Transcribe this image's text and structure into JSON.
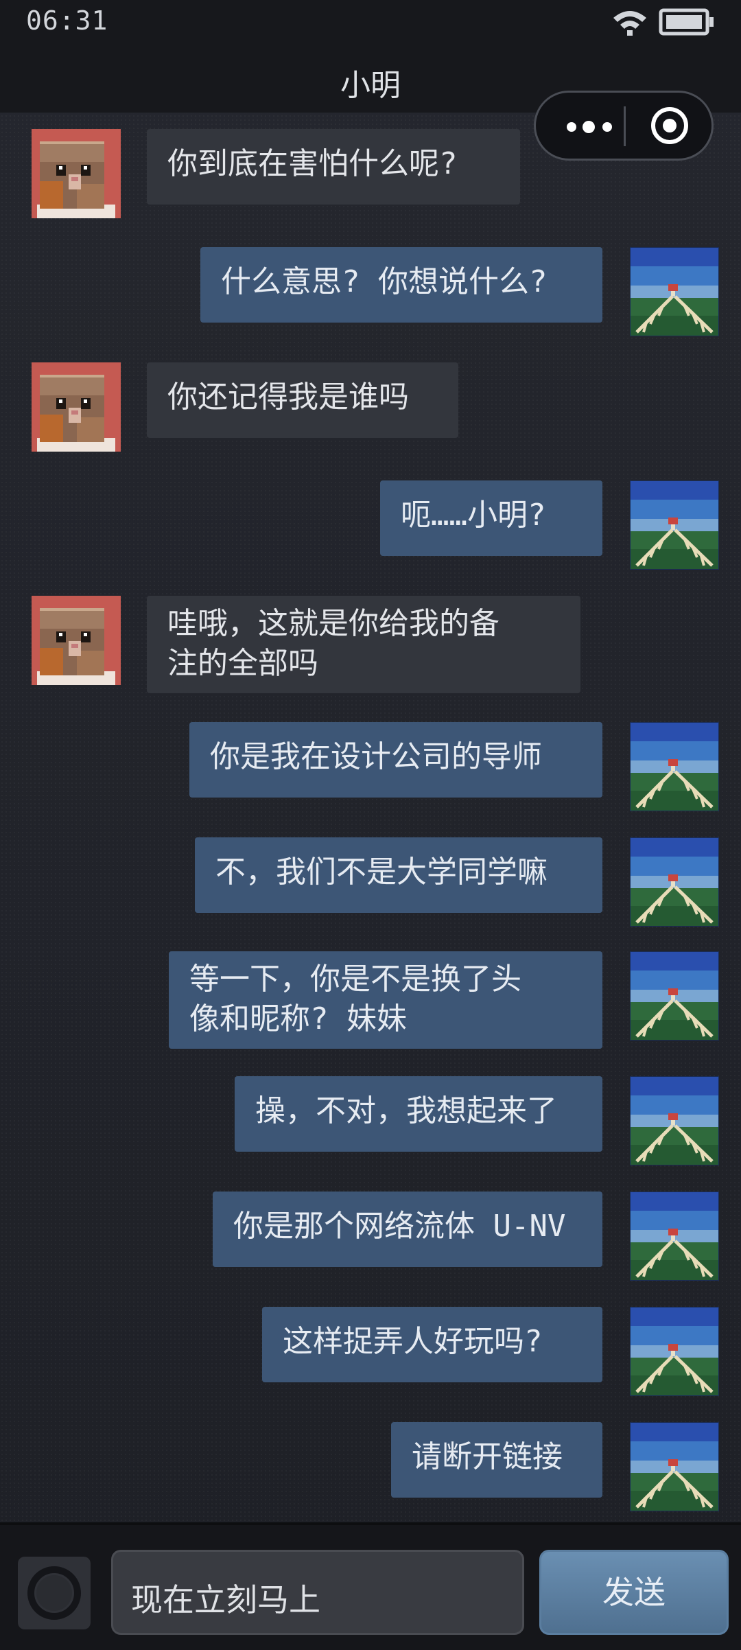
{
  "status_bar": {
    "time": "06:31"
  },
  "header": {
    "title": "小明"
  },
  "messages": [
    {
      "side": "in",
      "text": "你到底在害怕什么呢?"
    },
    {
      "side": "out",
      "text": "什么意思? 你想说什么?"
    },
    {
      "side": "in",
      "text": "你还记得我是谁吗"
    },
    {
      "side": "out",
      "text": "呃……小明?"
    },
    {
      "side": "in",
      "line1": "哇哦，这就是你给我的备",
      "line2": "注的全部吗"
    },
    {
      "side": "out",
      "text": "你是我在设计公司的导师"
    },
    {
      "side": "out",
      "text": "不，我们不是大学同学嘛"
    },
    {
      "side": "out",
      "line1": "等一下，你是不是换了头",
      "line2": "像和昵称? 妹妹"
    },
    {
      "side": "out",
      "text": "操，不对，我想起来了"
    },
    {
      "side": "out",
      "text": "你是那个网络流体 U-NV"
    },
    {
      "side": "out",
      "text": "这样捉弄人好玩吗?"
    },
    {
      "side": "out",
      "text": "请断开链接"
    }
  ],
  "composer": {
    "input_value": "现在立刻马上",
    "send_label": "发送"
  },
  "colors": {
    "incoming_bubble": "#33363d",
    "outgoing_bubble": "#3d5676",
    "send_button": "#5b7ea0"
  },
  "icons": {
    "contact_avatar": "cat-avatar-icon",
    "user_avatar": "landscape-avatar-icon"
  }
}
